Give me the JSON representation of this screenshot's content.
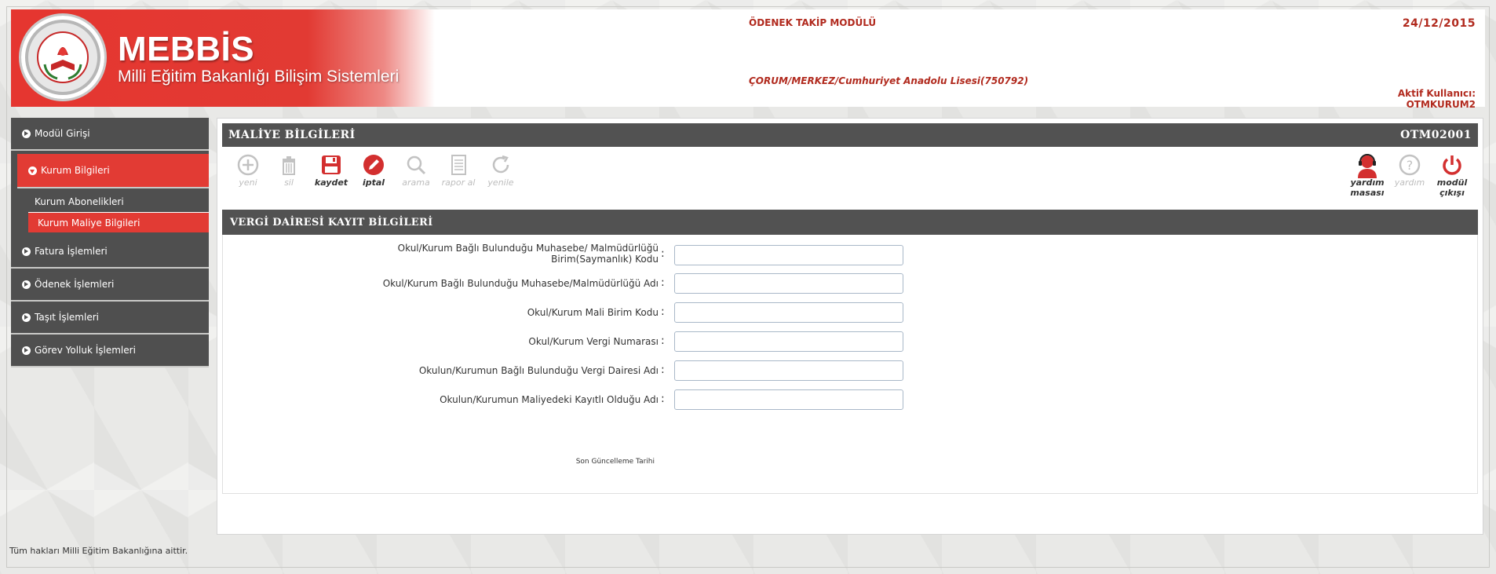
{
  "header": {
    "brand_title": "MEBBİS",
    "brand_subtitle": "Milli Eğitim Bakanlığı Bilişim Sistemleri",
    "module_title": "ÖDENEK TAKİP MODÜLÜ",
    "school": "ÇORUM/MERKEZ/Cumhuriyet Anadolu Lisesi(750792)",
    "date": "24/12/2015",
    "active_user_label": "Aktif Kullanıcı:",
    "active_user": "OTMKURUM2"
  },
  "sidebar": {
    "items": [
      {
        "label": "Modül Girişi"
      },
      {
        "label": "Kurum Bilgileri",
        "active": true
      },
      {
        "label": "Fatura İşlemleri"
      },
      {
        "label": "Ödenek İşlemleri"
      },
      {
        "label": "Taşıt İşlemleri"
      },
      {
        "label": "Görev Yolluk İşlemleri"
      }
    ],
    "sub_items": [
      {
        "label": "Kurum Abonelikleri"
      },
      {
        "label": "Kurum Maliye Bilgileri",
        "selected": true
      }
    ]
  },
  "panel": {
    "title": "MALİYE BİLGİLERİ",
    "code": "OTM02001"
  },
  "toolbar": {
    "new": "yeni",
    "delete": "sil",
    "save": "kaydet",
    "cancel": "iptal",
    "search": "arama",
    "report": "rapor al",
    "refresh": "yenile",
    "helpdesk_line1": "yardım",
    "helpdesk_line2": "masası",
    "help": "yardım",
    "exit_line1": "modül",
    "exit_line2": "çıkışı"
  },
  "form": {
    "section_title": "VERGİ DAİRESİ KAYIT BİLGİLERİ",
    "fields": [
      {
        "label_line1": "Okul/Kurum Bağlı Bulunduğu Muhasebe/ Malmüdürlüğü",
        "label_line2": "Birim(Saymanlık) Kodu",
        "value": ""
      },
      {
        "label_line1": "Okul/Kurum Bağlı Bulunduğu Muhasebe/Malmüdürlüğü Adı",
        "value": ""
      },
      {
        "label_line1": "Okul/Kurum Mali Birim Kodu",
        "value": ""
      },
      {
        "label_line1": "Okul/Kurum Vergi Numarası",
        "value": ""
      },
      {
        "label_line1": "Okulun/Kurumun Bağlı Bulunduğu Vergi Dairesi Adı",
        "value": ""
      },
      {
        "label_line1": "Okulun/Kurumun Maliyedeki Kayıtlı Olduğu Adı",
        "value": ""
      }
    ],
    "colon": ":",
    "last_update_label": "Son Güncelleme Tarihi"
  },
  "footer": {
    "text": "Tüm hakları Milli Eğitim Bakanlığına aittir."
  },
  "colors": {
    "accent_red": "#e23b34",
    "header_text_red": "#b12a1e",
    "bar_gray": "#525252"
  }
}
